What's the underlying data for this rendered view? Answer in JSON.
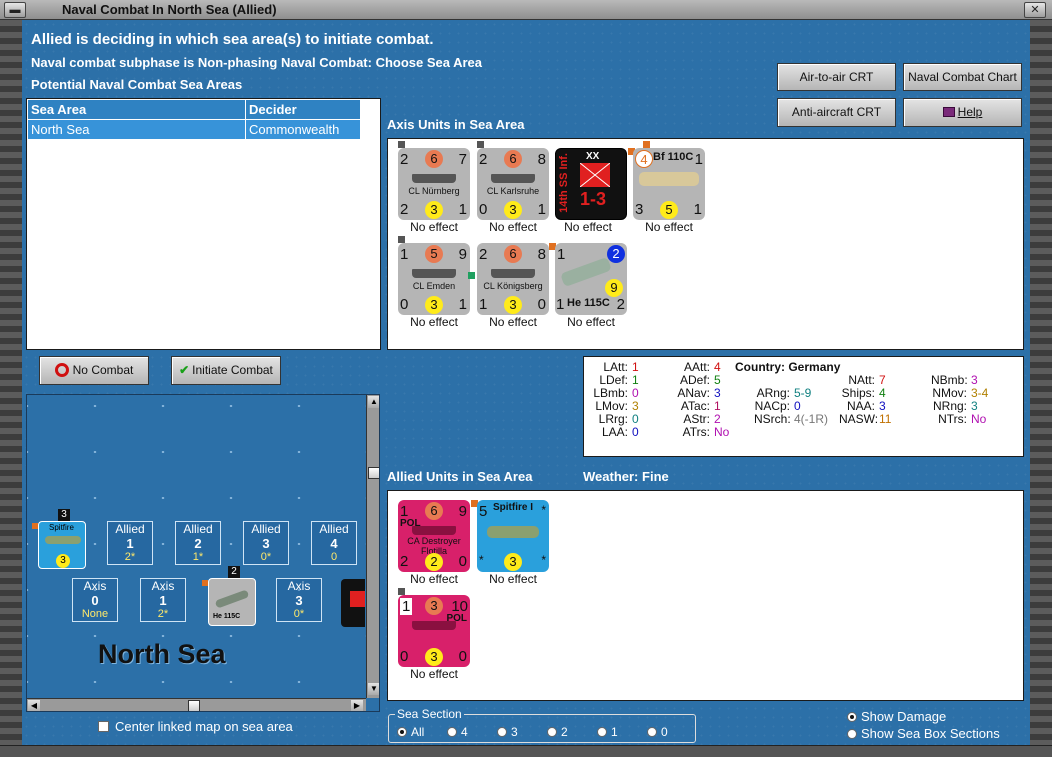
{
  "window": {
    "title": "Naval Combat In North Sea (Allied)"
  },
  "header": {
    "line1": "Allied is deciding in which sea area(s) to initiate combat.",
    "line2": "Naval combat subphase is Non-phasing Naval Combat: Choose Sea Area",
    "line3": "Potential Naval Combat Sea Areas"
  },
  "buttons": {
    "air_to_air": "Air-to-air CRT",
    "naval_chart": "Naval Combat Chart",
    "anti_aircraft": "Anti-aircraft CRT",
    "help": "Help",
    "no_combat": "No Combat",
    "initiate": "Initiate Combat"
  },
  "sea_table": {
    "col_area": "Sea Area",
    "col_decider": "Decider",
    "rows": [
      {
        "area": "North Sea",
        "decider": "Commonwealth"
      }
    ]
  },
  "axis": {
    "title": "Axis Units in Sea Area",
    "units": [
      {
        "name": "CL Nürnberg",
        "tl": "2",
        "tm": "6",
        "tr": "7",
        "bl": "2",
        "bm": "3",
        "br": "1",
        "effect": "No effect"
      },
      {
        "name": "CL Karlsruhe",
        "tl": "2",
        "tm": "6",
        "tr": "8",
        "bl": "0",
        "bm": "3",
        "br": "1",
        "effect": "No effect"
      },
      {
        "name": "14th SS Inf.",
        "size": "XX",
        "val": "1-3",
        "effect": "No effect"
      },
      {
        "name": "Bf 110C",
        "tl": "4",
        "tr": "1",
        "bl": "3",
        "bm": "5",
        "br": "1",
        "effect": "No effect"
      },
      {
        "name": "CL Emden",
        "tl": "1",
        "tm": "5",
        "tr": "9",
        "bl": "0",
        "bm": "3",
        "br": "1",
        "effect": "No effect"
      },
      {
        "name": "CL Königsberg",
        "tl": "2",
        "tm": "6",
        "tr": "8",
        "bl": "1",
        "bm": "3",
        "br": "0",
        "effect": "No effect"
      },
      {
        "name": "He 115C",
        "tl": "1",
        "tr": "2",
        "mid": "9",
        "bl": "1",
        "br": "2",
        "effect": "No effect"
      }
    ]
  },
  "stats": {
    "country_label": "Country:",
    "country": "Germany",
    "items": [
      {
        "k": "LAtt:",
        "v": "1",
        "c": "#d01010"
      },
      {
        "k": "LDef:",
        "v": "1",
        "c": "#108010"
      },
      {
        "k": "LBmb:",
        "v": "0",
        "c": "#b010b0"
      },
      {
        "k": "LMov:",
        "v": "3",
        "c": "#b08000"
      },
      {
        "k": "LRrg:",
        "v": "0",
        "c": "#108080"
      },
      {
        "k": "LAA:",
        "v": "0",
        "c": "#1010c0"
      },
      {
        "k": "AAtt:",
        "v": "4",
        "c": "#d01010"
      },
      {
        "k": "ADef:",
        "v": "5",
        "c": "#108010"
      },
      {
        "k": "ANav:",
        "v": "3",
        "c": "#1010c0"
      },
      {
        "k": "ATac:",
        "v": "1",
        "c": "#b01060"
      },
      {
        "k": "AStr:",
        "v": "2",
        "c": "#b010b0"
      },
      {
        "k": "ATrs:",
        "v": "No",
        "c": "#b010b0"
      },
      {
        "k": "ARng:",
        "v": "5-9",
        "c": "#108080"
      },
      {
        "k": "NACp:",
        "v": "0",
        "c": "#1010c0"
      },
      {
        "k": "NSrch:",
        "v": "4(-1R)",
        "c": "#777777"
      },
      {
        "k": "NAtt:",
        "v": "7",
        "c": "#d01010"
      },
      {
        "k": "Ships:",
        "v": "4",
        "c": "#108010"
      },
      {
        "k": "NAA:",
        "v": "3",
        "c": "#1010c0"
      },
      {
        "k": "NASW:",
        "v": "11",
        "c": "#c07000"
      },
      {
        "k": "NBmb:",
        "v": "3",
        "c": "#b010b0"
      },
      {
        "k": "NMov:",
        "v": "3-4",
        "c": "#b08000"
      },
      {
        "k": "NRng:",
        "v": "3",
        "c": "#108080"
      },
      {
        "k": "NTrs:",
        "v": "No",
        "c": "#b010b0"
      }
    ]
  },
  "allied": {
    "title": "Allied Units in Sea Area",
    "weather_label": "Weather:",
    "weather": "Fine",
    "units": [
      {
        "name": "CA Destroyer Flotilla",
        "nat": "POL",
        "tl": "1",
        "tm": "6",
        "tr": "9",
        "bl": "2",
        "bm": "2",
        "br": "0",
        "effect": "No effect"
      },
      {
        "name": "Spitfire I",
        "tl": "5",
        "tr": "*",
        "bm": "3",
        "bl": "*",
        "br": "*",
        "effect": "No effect"
      },
      {
        "name": "POL",
        "tl": "1",
        "tm": "3",
        "tr": "10",
        "bl": "0",
        "bm": "3",
        "br": "0",
        "effect": "No effect"
      }
    ]
  },
  "seabox": {
    "title": "North Sea",
    "allied_label": "Allied",
    "axis_label": "Axis",
    "allied": [
      {
        "n": "1",
        "s": "2*"
      },
      {
        "n": "2",
        "s": "1*"
      },
      {
        "n": "3",
        "s": "0*"
      },
      {
        "n": "4",
        "s": "0"
      }
    ],
    "axis": [
      {
        "n": "0",
        "s": "None"
      },
      {
        "n": "1",
        "s": "2*"
      },
      {
        "n": "3",
        "s": "0*"
      }
    ],
    "stack_counts": {
      "spitfire": "3",
      "he115": "2"
    },
    "spit_name": "Spitfire",
    "spit_val": "3",
    "he_name": "He 115C"
  },
  "center_link": "Center linked map on sea area",
  "sea_section": {
    "legend": "Sea Section",
    "options": [
      "All",
      "4",
      "3",
      "2",
      "1",
      "0"
    ],
    "selected": "All"
  },
  "display": {
    "show_damage": "Show Damage",
    "show_sections": "Show Sea Box Sections"
  }
}
